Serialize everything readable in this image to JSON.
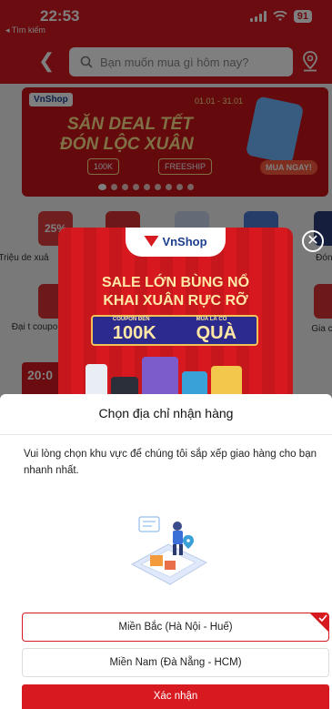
{
  "status_bar": {
    "time": "22:53",
    "back_app_label": "◂ Tìm kiếm",
    "battery": "91"
  },
  "header": {
    "search_placeholder": "Bạn muốn mua gì hôm nay?"
  },
  "hero_banner": {
    "brand": "VnShop",
    "date_range": "01.01 - 31.01",
    "title_line1": "SĂN DEAL TẾT",
    "title_line2": "ĐÓN LỘC XUÂN",
    "coupon1": "100K",
    "coupon2": "FREESHIP",
    "buy_label": "MUA NGAY!"
  },
  "tiles": {
    "t1_badge": "25%",
    "t1_label": "Triệu de xuả",
    "t2_label": "Đại t coupo",
    "t3_label": "Đón xu",
    "t4_label": "Gia c"
  },
  "promo_strip": {
    "time": "20:0"
  },
  "popup": {
    "brand": "VnShop",
    "headline1": "SALE LỚN BÙNG NỔ",
    "headline2": "KHAI XUÂN RỰC RỠ",
    "coupon_caption": "COUPON ĐẾN",
    "coupon_value": "100K",
    "gift_caption": "MUA LÀ CÓ",
    "gift_value": "QUÀ"
  },
  "sheet": {
    "title": "Chọn địa chỉ nhận hàng",
    "description": "Vui lòng chọn khu vực để chúng tôi sắp xếp giao hàng cho bạn nhanh nhất.",
    "options": [
      {
        "label": "Miền Bắc (Hà Nội - Huế)",
        "selected": true
      },
      {
        "label": "Miền Nam (Đà Nẵng - HCM)",
        "selected": false
      }
    ],
    "confirm_label": "Xác nhận"
  },
  "colors": {
    "brand_red": "#d71920",
    "brand_blue": "#1d3f8f"
  }
}
